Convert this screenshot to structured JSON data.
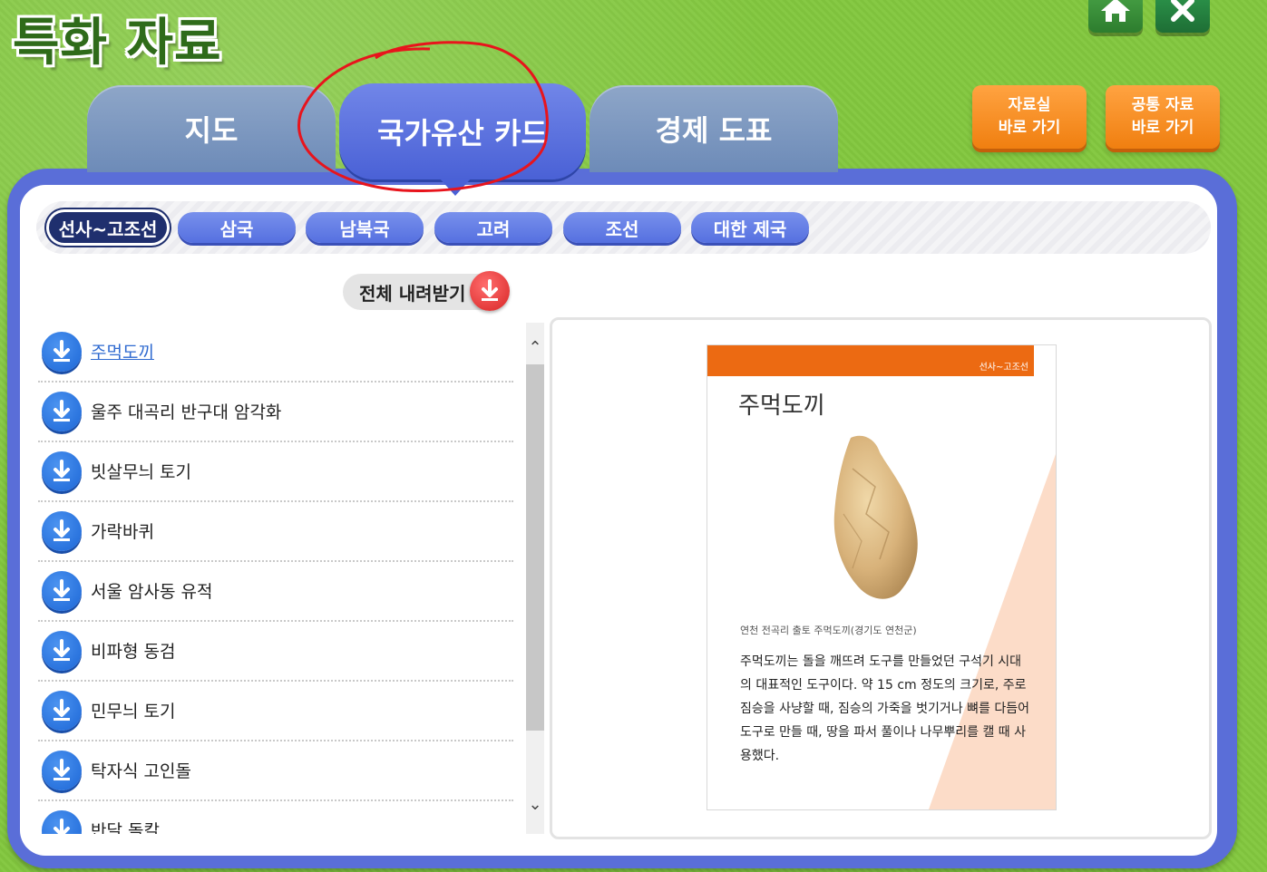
{
  "header": {
    "title": "특화 자료"
  },
  "top_buttons": {
    "home_icon": "home-icon",
    "close_icon": "close-icon"
  },
  "shortcuts": [
    {
      "line1": "자료실",
      "line2": "바로 가기"
    },
    {
      "line1": "공통 자료",
      "line2": "바로 가기"
    }
  ],
  "tabs": [
    {
      "label": "지도"
    },
    {
      "label": "국가유산 카드"
    },
    {
      "label": "경제 도표"
    }
  ],
  "eras": [
    {
      "label": "선사~고조선"
    },
    {
      "label": "삼국"
    },
    {
      "label": "남북국"
    },
    {
      "label": "고려"
    },
    {
      "label": "조선"
    },
    {
      "label": "대한 제국"
    }
  ],
  "download_all": {
    "label": "전체 내려받기"
  },
  "items": [
    {
      "label": "주먹도끼"
    },
    {
      "label": "울주 대곡리 반구대 암각화"
    },
    {
      "label": "빗살무늬 토기"
    },
    {
      "label": "가락바퀴"
    },
    {
      "label": "서울 암사동 유적"
    },
    {
      "label": "비파형 동검"
    },
    {
      "label": "민무늬 토기"
    },
    {
      "label": "탁자식 고인돌"
    },
    {
      "label": "반달 돌칼"
    }
  ],
  "card": {
    "era": "선사~고조선",
    "title": "주먹도끼",
    "caption": "연천 전곡리 출토 주먹도끼(경기도 연천군)",
    "description": "주먹도끼는 돌을 깨뜨려 도구를 만들었던 구석기 시대의 대표적인 도구이다. 약 15 cm 정도의 크기로, 주로 짐승을 사냥할 때, 짐승의 가죽을 벗기거나 뼈를 다듬어 도구로 만들 때, 땅을 파서 풀이나 나무뿌리를 캘 때 사용했다."
  },
  "colors": {
    "active_tab": "#4a61d6",
    "annotation": "#e8141c",
    "card_accent": "#ec6a12"
  }
}
